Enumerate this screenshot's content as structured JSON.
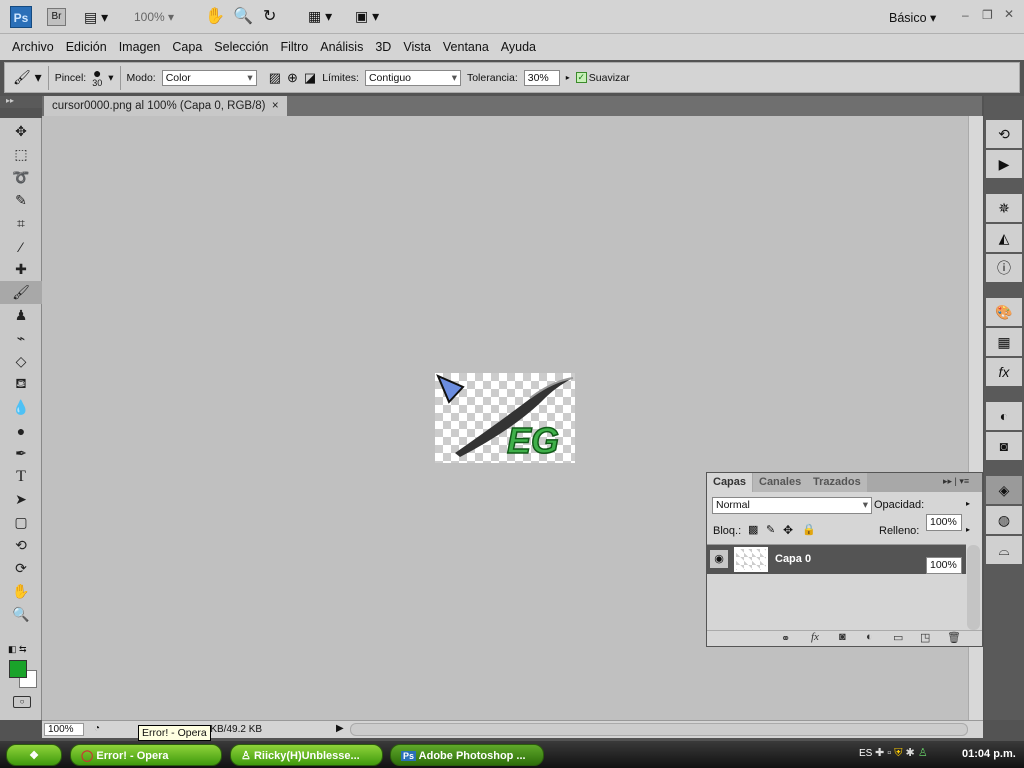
{
  "appbar": {
    "ps": "Ps",
    "br": "Br",
    "zoom": "100%",
    "workspace": "Básico"
  },
  "menu": [
    "Archivo",
    "Edición",
    "Imagen",
    "Capa",
    "Selección",
    "Filtro",
    "Análisis",
    "3D",
    "Vista",
    "Ventana",
    "Ayuda"
  ],
  "options": {
    "brush_label": "Pincel:",
    "brush_size": "30",
    "mode_label": "Modo:",
    "mode_value": "Color",
    "limits_label": "Límites:",
    "limits_value": "Contiguo",
    "tolerance_label": "Tolerancia:",
    "tolerance_value": "30%",
    "smooth_label": "Suavizar",
    "smooth_checked": true
  },
  "document": {
    "tab_title": "cursor0000.png al 100% (Capa 0, RGB/8)",
    "close": "×",
    "art_text": "EG"
  },
  "status": {
    "zoom": "100%",
    "doc_size": "9 KB/49.2 KB",
    "tooltip": "Error! - Opera"
  },
  "colors": {
    "foreground": "#1aa32a",
    "background": "#ffffff"
  },
  "layers_panel": {
    "tabs": [
      "Capas",
      "Canales",
      "Trazados"
    ],
    "blend_mode": "Normal",
    "opacity_label": "Opacidad:",
    "opacity": "100%",
    "lock_label": "Bloq.:",
    "fill_label": "Relleno:",
    "fill": "100%",
    "layers": [
      {
        "name": "Capa 0",
        "visible": true,
        "selected": true
      }
    ]
  },
  "taskbar": {
    "items": [
      "Error! - Opera",
      "Riicky(H)Unblesse...",
      "Adobe Photoshop ..."
    ],
    "lang": "ES",
    "clock": "01:04 p.m."
  }
}
